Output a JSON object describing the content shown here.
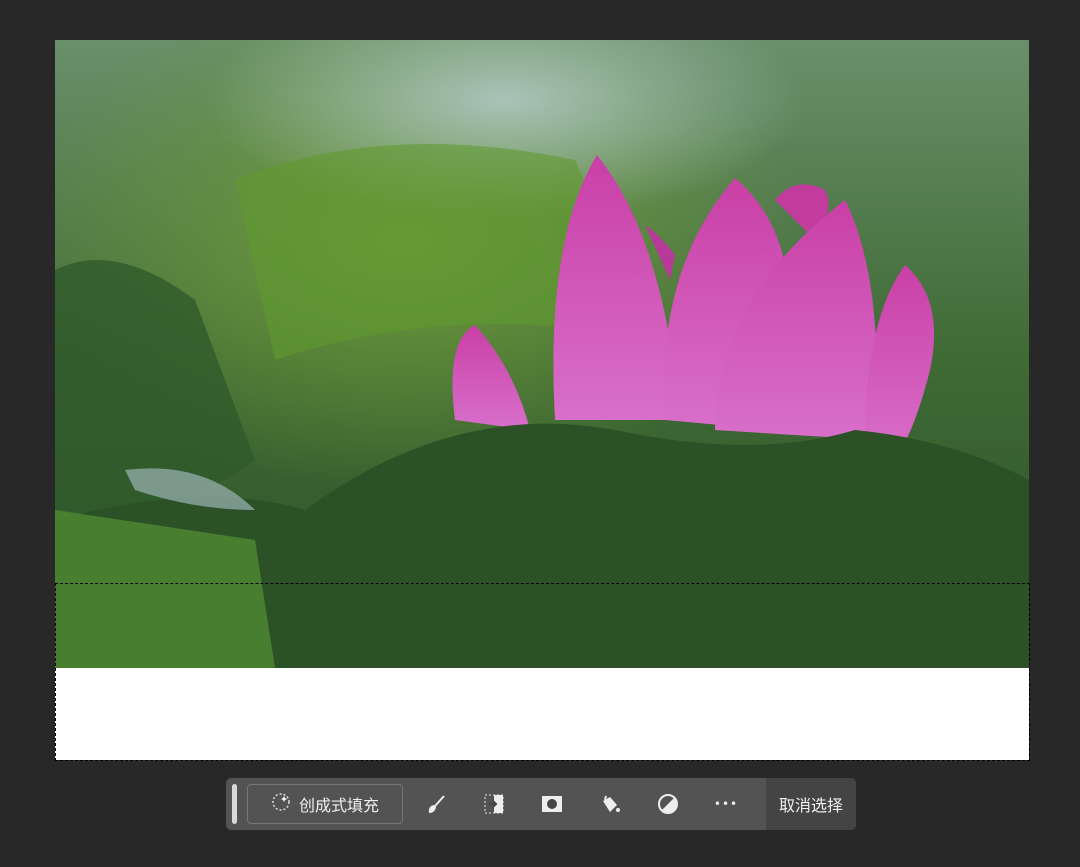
{
  "toolbar": {
    "generative_fill_label": "创成式填充",
    "more_label": "•••",
    "deselect_label": "取消选择"
  },
  "colors": {
    "canvas_bg": "#282828",
    "toolbar_bg": "#535353",
    "lotus": "#c94fae"
  }
}
